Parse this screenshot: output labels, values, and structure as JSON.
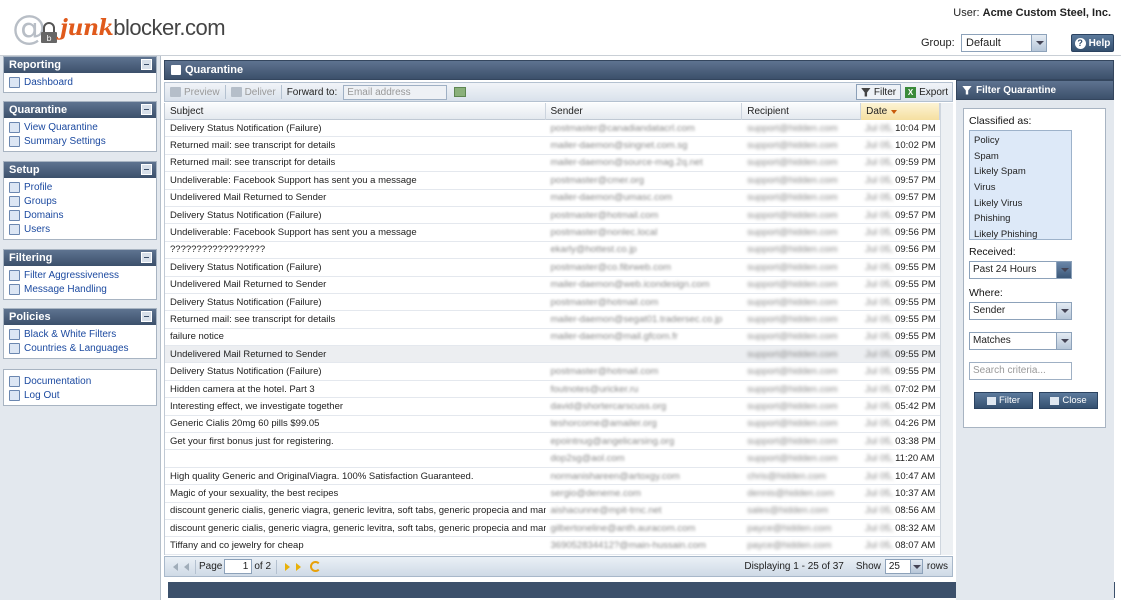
{
  "header": {
    "logo_prefix": "junk",
    "logo_suffix": "blocker.com",
    "user_label": "User:",
    "user_name": "Acme Custom Steel, Inc.",
    "group_label": "Group:",
    "group_value": "Default",
    "help_label": "Help"
  },
  "nav": {
    "reporting": {
      "title": "Reporting",
      "items": [
        "Dashboard"
      ]
    },
    "quarantine": {
      "title": "Quarantine",
      "items": [
        "View Quarantine",
        "Summary Settings"
      ]
    },
    "setup": {
      "title": "Setup",
      "items": [
        "Profile",
        "Groups",
        "Domains",
        "Users"
      ]
    },
    "filtering": {
      "title": "Filtering",
      "items": [
        "Filter Aggressiveness",
        "Message Handling"
      ]
    },
    "policies": {
      "title": "Policies",
      "items": [
        "Black & White Filters",
        "Countries & Languages"
      ]
    },
    "misc": {
      "items": [
        "Documentation",
        "Log Out"
      ]
    }
  },
  "main": {
    "title": "Quarantine",
    "toolbar": {
      "preview": "Preview",
      "deliver": "Deliver",
      "forward_to": "Forward to:",
      "email_placeholder": "Email address",
      "filter": "Filter",
      "export": "Export"
    },
    "columns": [
      "Subject",
      "Sender",
      "Recipient",
      "Date"
    ],
    "rows": [
      {
        "subject": "Delivery Status Notification (Failure)",
        "sender": "postmaster@canadiandatacrl.com",
        "recipient": "support@hidden.com",
        "date": "Jul 05,",
        "time": "10:04 PM"
      },
      {
        "subject": "Returned mail: see transcript for details",
        "sender": "mailer-daemon@singnet.com.sg",
        "recipient": "support@hidden.com",
        "date": "Jul 05,",
        "time": "10:02 PM"
      },
      {
        "subject": "Returned mail: see transcript for details",
        "sender": "mailer-daemon@source-mag.2q.net",
        "recipient": "support@hidden.com",
        "date": "Jul 05,",
        "time": "09:59 PM"
      },
      {
        "subject": "Undeliverable: Facebook Support has sent you a message",
        "sender": "postmaster@cmer.org",
        "recipient": "support@hidden.com",
        "date": "Jul 05,",
        "time": "09:57 PM"
      },
      {
        "subject": "Undelivered Mail Returned to Sender",
        "sender": "mailer-daemon@umasc.com",
        "recipient": "support@hidden.com",
        "date": "Jul 05,",
        "time": "09:57 PM"
      },
      {
        "subject": "Delivery Status Notification (Failure)",
        "sender": "postmaster@hotmail.com",
        "recipient": "support@hidden.com",
        "date": "Jul 05,",
        "time": "09:57 PM"
      },
      {
        "subject": "Undeliverable: Facebook Support has sent you a message",
        "sender": "postmaster@nonlec.local",
        "recipient": "support@hidden.com",
        "date": "Jul 05,",
        "time": "09:56 PM"
      },
      {
        "subject": "??????????????????",
        "sender": "ekarly@hottest.co.jp",
        "recipient": "support@hidden.com",
        "date": "Jul 05,",
        "time": "09:56 PM"
      },
      {
        "subject": "Delivery Status Notification (Failure)",
        "sender": "postmaster@co.fibrweb.com",
        "recipient": "support@hidden.com",
        "date": "Jul 05,",
        "time": "09:55 PM"
      },
      {
        "subject": "Undelivered Mail Returned to Sender",
        "sender": "mailer-daemon@web.icondesign.com",
        "recipient": "support@hidden.com",
        "date": "Jul 05,",
        "time": "09:55 PM"
      },
      {
        "subject": "Delivery Status Notification (Failure)",
        "sender": "postmaster@hotmail.com",
        "recipient": "support@hidden.com",
        "date": "Jul 05,",
        "time": "09:55 PM"
      },
      {
        "subject": "Returned mail: see transcript for details",
        "sender": "mailer-daemon@segat01.tradersec.co.jp",
        "recipient": "support@hidden.com",
        "date": "Jul 05,",
        "time": "09:55 PM"
      },
      {
        "subject": "failure notice",
        "sender": "mailer-daemon@mail.gfcom.fr",
        "recipient": "support@hidden.com",
        "date": "Jul 05,",
        "time": "09:55 PM"
      },
      {
        "subject": "Undelivered Mail Returned to Sender",
        "sender": "",
        "recipient": "support@hidden.com",
        "date": "Jul 05,",
        "time": "09:55 PM",
        "selected": true
      },
      {
        "subject": "Delivery Status Notification (Failure)",
        "sender": "postmaster@hotmail.com",
        "recipient": "support@hidden.com",
        "date": "Jul 05,",
        "time": "09:55 PM"
      },
      {
        "subject": "Hidden camera at the hotel. Part 3",
        "sender": "foutnotes@uricker.ru",
        "recipient": "support@hidden.com",
        "date": "Jul 05,",
        "time": "07:02 PM"
      },
      {
        "subject": "Interesting effect, we investigate together",
        "sender": "david@shortercarscuss.org",
        "recipient": "support@hidden.com",
        "date": "Jul 05,",
        "time": "05:42 PM"
      },
      {
        "subject": "Generic Cialis 20mg 60 pills $99.05",
        "sender": "teshorcome@amailer.org",
        "recipient": "support@hidden.com",
        "date": "Jul 05,",
        "time": "04:26 PM"
      },
      {
        "subject": "Get your first bonus just for registering.",
        "sender": "epointnug@angelicarsing.org",
        "recipient": "support@hidden.com",
        "date": "Jul 05,",
        "time": "03:38 PM"
      },
      {
        "subject": "",
        "sender": "dop2sg@aol.com",
        "recipient": "support@hidden.com",
        "date": "Jul 05,",
        "time": "11:20 AM"
      },
      {
        "subject": "High quality Generic and OriginalViagra. 100% Satisfaction Guaranteed.",
        "sender": "normanishareen@artoxgy.com",
        "recipient": "chris@hidden.com",
        "date": "Jul 05,",
        "time": "10:47 AM"
      },
      {
        "subject": "Magic of your sexuality, the best recipes",
        "sender": "sergio@deneme.com",
        "recipient": "dennis@hidden.com",
        "date": "Jul 05,",
        "time": "10:37 AM"
      },
      {
        "subject": "discount generic cialis, generic viagra, generic levitra, soft tabs, generic propecia and many more",
        "sender": "aishacunne@mpit-trnc.net",
        "recipient": "sales@hidden.com",
        "date": "Jul 05,",
        "time": "08:56 AM"
      },
      {
        "subject": "discount generic cialis, generic viagra, generic levitra, soft tabs, generic propecia and many more",
        "sender": "gilbertoneline@anth.auracom.com",
        "recipient": "payce@hidden.com",
        "date": "Jul 05,",
        "time": "08:32 AM"
      },
      {
        "subject": "Tiffany and co jewelry for cheap",
        "sender": "369052834412?@main-hussain.com",
        "recipient": "payce@hidden.com",
        "date": "Jul 05,",
        "time": "08:07 AM"
      }
    ],
    "pager": {
      "page_label": "Page",
      "page_value": "1",
      "of_label": "of 2",
      "displaying": "Displaying 1 - 25 of 37",
      "show_label": "Show",
      "show_value": "25",
      "rows_label": "rows"
    }
  },
  "filter_panel": {
    "title": "Filter Quarantine",
    "classified_label": "Classified as:",
    "classified_options": [
      "Policy",
      "Spam",
      "Likely Spam",
      "Virus",
      "Likely Virus",
      "Phishing",
      "Likely Phishing"
    ],
    "received_label": "Received:",
    "received_value": "Past 24 Hours",
    "where_label": "Where:",
    "where_value": "Sender",
    "match_value": "Matches",
    "search_placeholder": "Search criteria...",
    "filter_button": "Filter",
    "close_button": "Close"
  }
}
